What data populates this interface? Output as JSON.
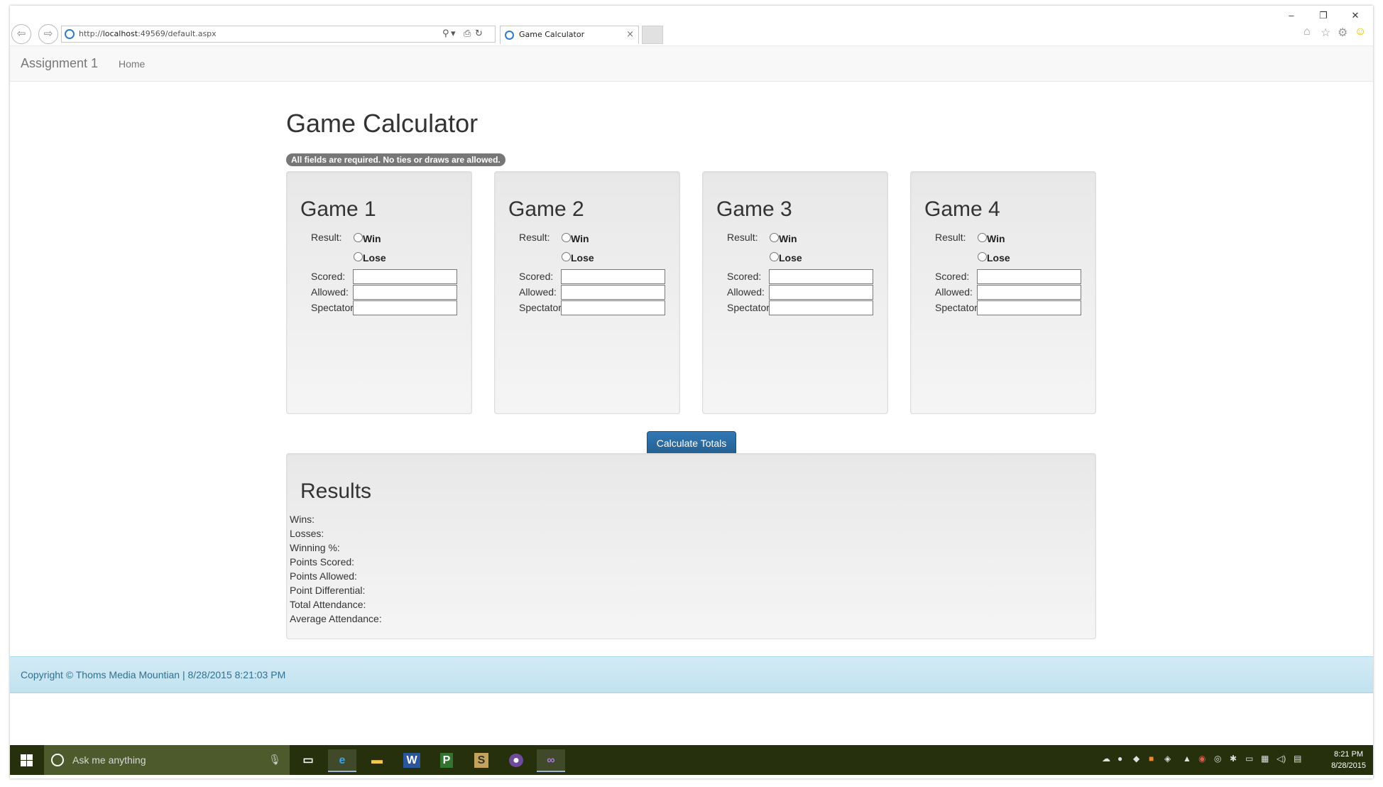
{
  "browser": {
    "url_prefix": "http://",
    "url_host": "localhost",
    "url_rest": ":49569/default.aspx",
    "tab_title": "Game Calculator",
    "tab_close": "×",
    "back_icon": "back-arrow-icon",
    "forward_icon": "forward-arrow-icon"
  },
  "navbar": {
    "brand": "Assignment 1",
    "home": "Home"
  },
  "page": {
    "title": "Game Calculator",
    "requirement_badge": "All fields are required. No ties or draws are allowed."
  },
  "labels": {
    "result": "Result:",
    "win": "Win",
    "lose": "Lose",
    "scored": "Scored:",
    "allowed": "Allowed:",
    "spectator": "Spectator"
  },
  "games": [
    {
      "title": "Game 1",
      "scored": "",
      "allowed": "",
      "spectators": ""
    },
    {
      "title": "Game 2",
      "scored": "",
      "allowed": "",
      "spectators": ""
    },
    {
      "title": "Game 3",
      "scored": "",
      "allowed": "",
      "spectators": ""
    },
    {
      "title": "Game 4",
      "scored": "",
      "allowed": "",
      "spectators": ""
    }
  ],
  "calculate_button": "Calculate Totals",
  "results": {
    "title": "Results",
    "lines": [
      "Wins:",
      "Losses:",
      "Winning %:",
      "Points Scored:",
      "Points Allowed:",
      "Point Differential:",
      "Total Attendance:",
      "Average Attendance:"
    ]
  },
  "footer": {
    "text": "Copyright © Thoms Media Mountian | 8/28/2015 8:21:03 PM"
  },
  "taskbar": {
    "search_placeholder": "Ask me anything",
    "time": "8:21 PM",
    "date": "8/28/2015"
  },
  "colors": {
    "primary_button": "#2b6aa3",
    "footer_bg": "#c9e6f2",
    "taskbar_bg": "#26300c",
    "badge_bg": "#777777"
  }
}
